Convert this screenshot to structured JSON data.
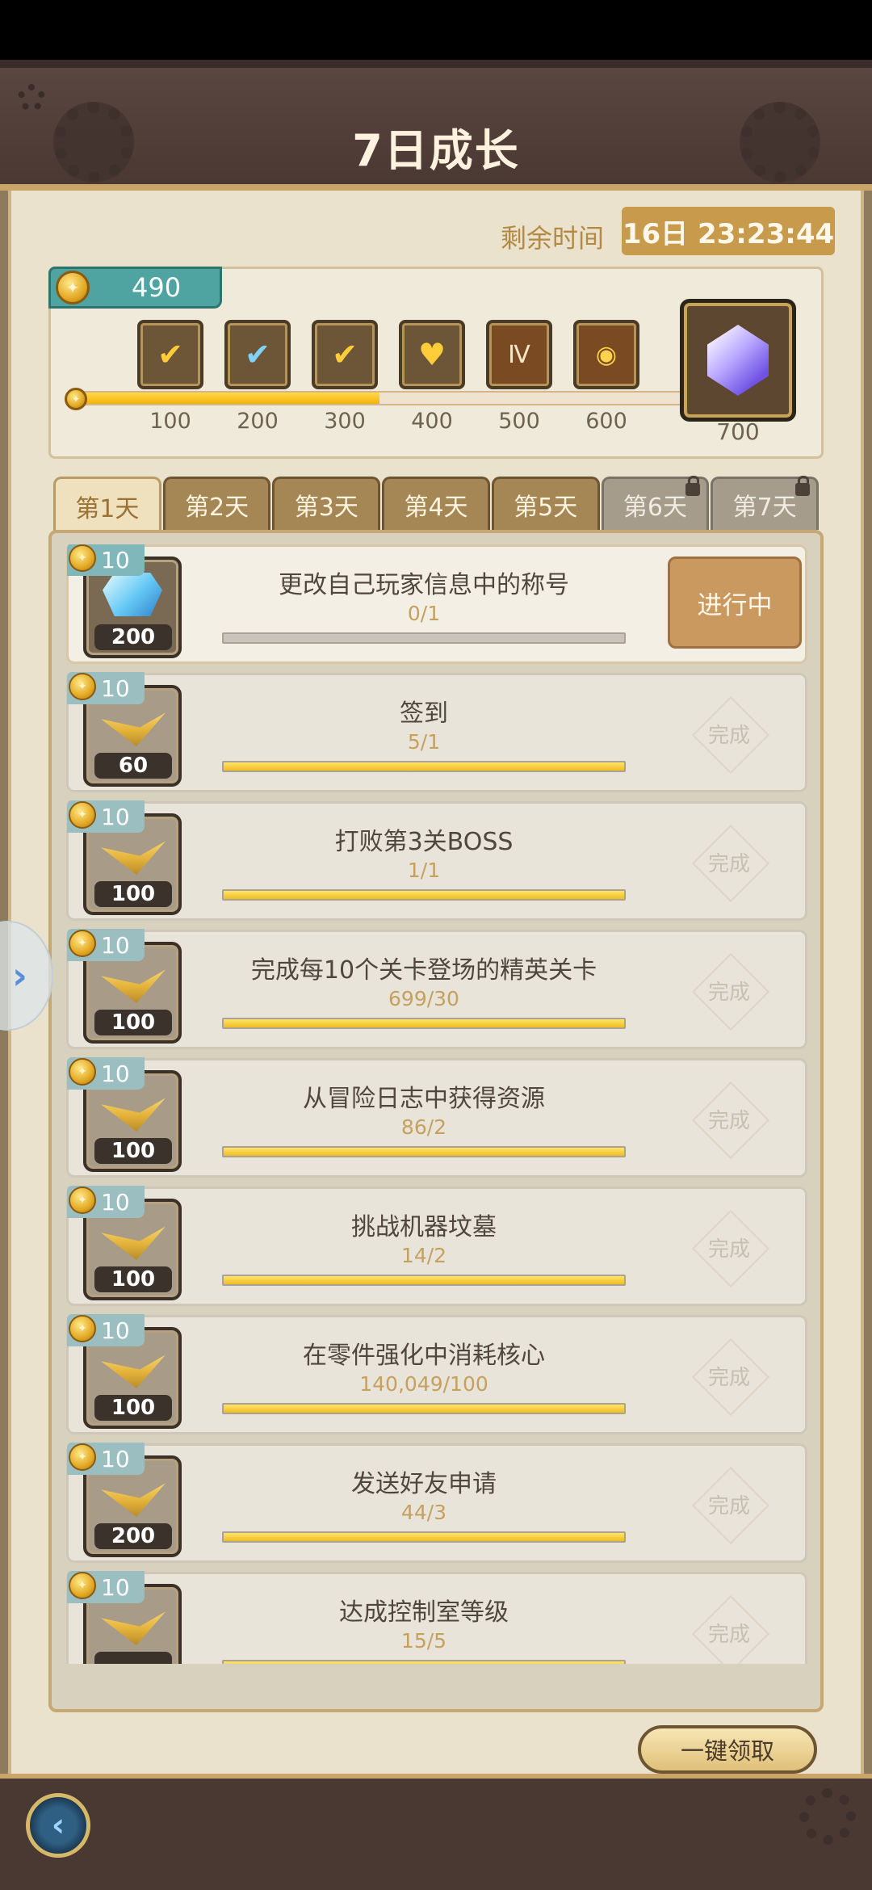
{
  "header": {
    "title": "7日成长"
  },
  "timer": {
    "label": "剩余时间",
    "value": "16日 23:23:44"
  },
  "points": {
    "current": "490",
    "progress_fraction": 0.49
  },
  "milestones": [
    {
      "value": "100",
      "icon": "gold-card-icon"
    },
    {
      "value": "200",
      "icon": "gem-card-icon"
    },
    {
      "value": "300",
      "icon": "gold-boomerang-icon"
    },
    {
      "value": "400",
      "icon": "gold-heart-card-icon"
    },
    {
      "value": "500",
      "icon": "equipment-chest-icon"
    },
    {
      "value": "600",
      "icon": "egg-x30-icon"
    }
  ],
  "final_reward": {
    "value": "700",
    "icon": "crystal-icon"
  },
  "tabs": [
    {
      "label": "第1天",
      "active": true,
      "locked": false
    },
    {
      "label": "第2天",
      "active": false,
      "locked": false
    },
    {
      "label": "第3天",
      "active": false,
      "locked": false
    },
    {
      "label": "第4天",
      "active": false,
      "locked": false
    },
    {
      "label": "第5天",
      "active": false,
      "locked": false
    },
    {
      "label": "第6天",
      "active": false,
      "locked": true
    },
    {
      "label": "第7天",
      "active": false,
      "locked": true
    }
  ],
  "tasks": [
    {
      "points": "10",
      "reward_count": "200",
      "reward_icon": "gem-icon",
      "title": "更改自己玩家信息中的称号",
      "progress": "0/1",
      "fill": 0,
      "state": "进行中"
    },
    {
      "points": "10",
      "reward_count": "60",
      "reward_icon": "gold-card-icon",
      "title": "签到",
      "progress": "5/1",
      "fill": 1,
      "state": "完成"
    },
    {
      "points": "10",
      "reward_count": "100",
      "reward_icon": "gem-card-icon",
      "title": "打败第3关BOSS",
      "progress": "1/1",
      "fill": 1,
      "state": "完成"
    },
    {
      "points": "10",
      "reward_count": "100",
      "reward_icon": "gem-card-icon",
      "title": "完成每10个关卡登场的精英关卡",
      "progress": "699/30",
      "fill": 1,
      "state": "完成"
    },
    {
      "points": "10",
      "reward_count": "100",
      "reward_icon": "gem-card-icon",
      "title": "从冒险日志中获得资源",
      "progress": "86/2",
      "fill": 1,
      "state": "完成"
    },
    {
      "points": "10",
      "reward_count": "100",
      "reward_icon": "gem-card-icon",
      "title": "挑战机器坟墓",
      "progress": "14/2",
      "fill": 1,
      "state": "完成"
    },
    {
      "points": "10",
      "reward_count": "100",
      "reward_icon": "gem-card-icon",
      "title": "在零件强化中消耗核心",
      "progress": "140,049/100",
      "fill": 1,
      "state": "完成"
    },
    {
      "points": "10",
      "reward_count": "200",
      "reward_icon": "gem-card-icon",
      "title": "发送好友申请",
      "progress": "44/3",
      "fill": 1,
      "state": "完成"
    },
    {
      "points": "10",
      "reward_count": "",
      "reward_icon": "gem-card-icon",
      "title": "达成控制室等级",
      "progress": "15/5",
      "fill": 1,
      "state": "完成"
    }
  ],
  "footer": {
    "claim_all_label": "一键领取"
  }
}
